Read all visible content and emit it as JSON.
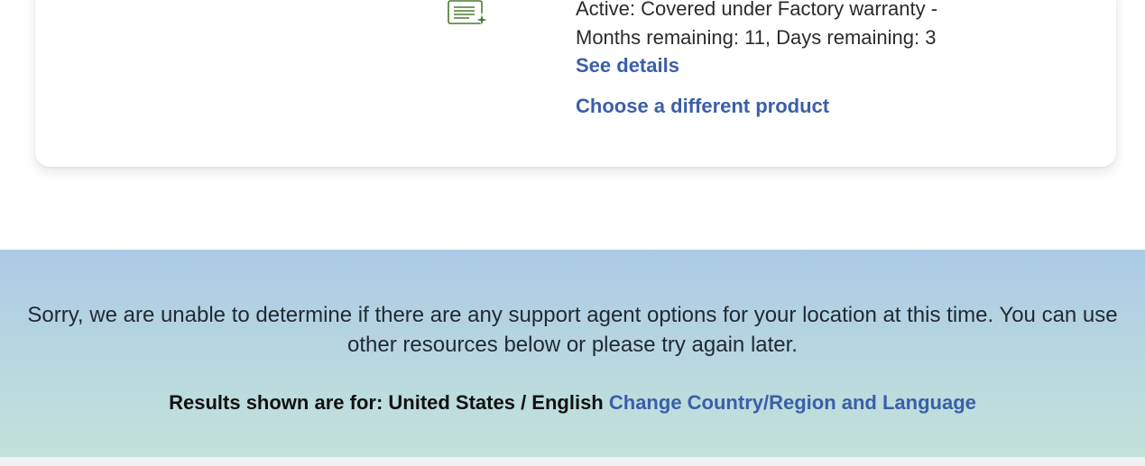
{
  "warranty": {
    "icon": "warranty-certificate-icon",
    "icon_color": "#4a7a2e",
    "status_line1": "Active: Covered under Factory warranty -",
    "status_line2": "Months remaining: 11, Days remaining: 3",
    "see_details_label": "See details",
    "choose_product_label": "Choose a different product"
  },
  "support_banner": {
    "message": "Sorry, we are unable to determine if there are any support agent options for your location at this time. You can use other resources below or please try again later.",
    "results_label": "Results shown are for: United States / English",
    "change_link_label": "Change Country/Region and Language"
  },
  "colors": {
    "link": "#3b5fa8",
    "banner_top": "#abc9e6",
    "banner_bottom": "#c2e2d9"
  }
}
